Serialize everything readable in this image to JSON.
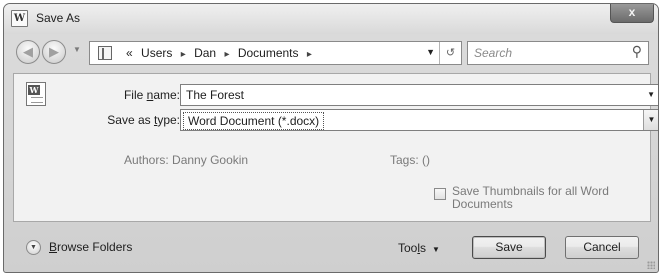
{
  "window": {
    "title": "Save As",
    "close_label": "x",
    "app_icon_label": "W"
  },
  "nav": {
    "breadcrumb_prefix": "«",
    "breadcrumbs": [
      "Users",
      "Dan",
      "Documents"
    ],
    "search_placeholder": "Search"
  },
  "form": {
    "filename_label_pre": "File ",
    "filename_label_key": "n",
    "filename_label_post": "ame:",
    "filename_value": "The Forest",
    "type_label_pre": "Save as ",
    "type_label_key": "t",
    "type_label_post": "ype:",
    "type_value": "Word Document (*.docx)",
    "authors_label": "Authors:",
    "authors_value": "Danny Gookin",
    "tags_label": "Tags:",
    "tags_value": "()",
    "thumbnails_label": "Save Thumbnails for all Word Documents",
    "thumbnails_checked": false
  },
  "footer": {
    "browse_key": "B",
    "browse_rest": "rowse Folders",
    "tools_pre": "Too",
    "tools_key": "l",
    "tools_post": "s",
    "save_label": "Save",
    "cancel_label": "Cancel"
  },
  "icons": {
    "app": "word-app-icon",
    "back": "back-arrow-icon",
    "forward": "forward-arrow-icon",
    "folder": "folder-icon",
    "refresh": "refresh-icon",
    "search": "search-icon",
    "document": "word-document-icon",
    "browse": "expand-chevron-icon"
  }
}
